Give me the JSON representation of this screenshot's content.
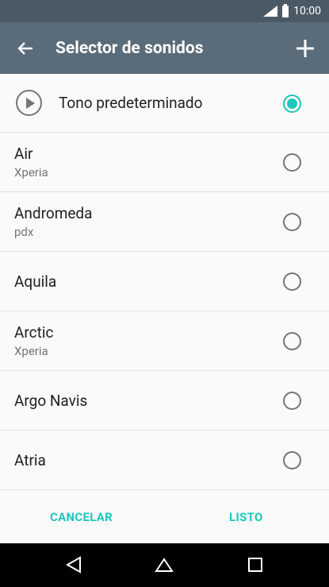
{
  "status_bar": {
    "time": "10:00"
  },
  "app_bar": {
    "title": "Selector de sonidos"
  },
  "default_item": {
    "label": "Tono predeterminado",
    "selected": true
  },
  "items": [
    {
      "name": "Air",
      "subtitle": "Xperia"
    },
    {
      "name": "Andromeda",
      "subtitle": "pdx"
    },
    {
      "name": "Aquila",
      "subtitle": ""
    },
    {
      "name": "Arctic",
      "subtitle": "Xperia"
    },
    {
      "name": "Argo Navis",
      "subtitle": ""
    },
    {
      "name": "Atria",
      "subtitle": ""
    }
  ],
  "footer": {
    "cancel_label": "CANCELAR",
    "done_label": "LISTO"
  },
  "colors": {
    "accent": "#1ec6bb",
    "app_bar": "#5a6b79",
    "status_bar": "#4a5966"
  }
}
